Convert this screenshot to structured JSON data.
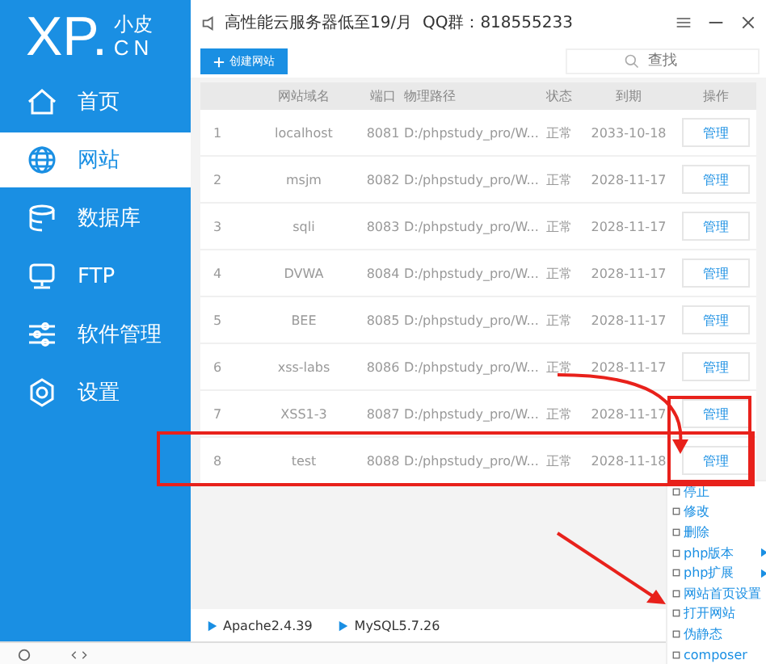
{
  "logo": {
    "main": "XP.",
    "top": "小皮",
    "bottom": "CN"
  },
  "sidebar": {
    "items": [
      {
        "label": "首页",
        "selected": false
      },
      {
        "label": "网站",
        "selected": true
      },
      {
        "label": "数据库",
        "selected": false
      },
      {
        "label": "FTP",
        "selected": false
      },
      {
        "label": "软件管理",
        "selected": false
      },
      {
        "label": "设置",
        "selected": false
      }
    ]
  },
  "title_bar": {
    "title": "高性能云服务器低至19/月  QQ群：818555233"
  },
  "toolbar": {
    "create_button": "创建网站",
    "search": {
      "placeholder": "查找"
    }
  },
  "table": {
    "columns": [
      "",
      "网站域名",
      "端口",
      "物理路径",
      "状态",
      "到期",
      "操作"
    ],
    "rows": [
      {
        "index": "1",
        "domain": "localhost",
        "port": "8081",
        "path": "D:/phpstudy_pro/W...",
        "status": "正常",
        "expires": "2033-10-18",
        "action": "管理"
      },
      {
        "index": "2",
        "domain": "msjm",
        "port": "8082",
        "path": "D:/phpstudy_pro/W...",
        "status": "正常",
        "expires": "2028-11-17",
        "action": "管理"
      },
      {
        "index": "3",
        "domain": "sqli",
        "port": "8083",
        "path": "D:/phpstudy_pro/W...",
        "status": "正常",
        "expires": "2028-11-17",
        "action": "管理"
      },
      {
        "index": "4",
        "domain": "DVWA",
        "port": "8084",
        "path": "D:/phpstudy_pro/W...",
        "status": "正常",
        "expires": "2028-11-17",
        "action": "管理"
      },
      {
        "index": "5",
        "domain": "BEE",
        "port": "8085",
        "path": "D:/phpstudy_pro/W...",
        "status": "正常",
        "expires": "2028-11-17",
        "action": "管理"
      },
      {
        "index": "6",
        "domain": "xss-labs",
        "port": "8086",
        "path": "D:/phpstudy_pro/W...",
        "status": "正常",
        "expires": "2028-11-17",
        "action": "管理"
      },
      {
        "index": "7",
        "domain": "XSS1-3",
        "port": "8087",
        "path": "D:/phpstudy_pro/W...",
        "status": "正常",
        "expires": "2028-11-17",
        "action": "管理"
      },
      {
        "index": "8",
        "domain": "test",
        "port": "8088",
        "path": "D:/phpstudy_pro/W...",
        "status": "正常",
        "expires": "2028-11-18",
        "action": "管理"
      }
    ]
  },
  "status_bar": [
    "Apache2.4.39",
    "MySQL5.7.26"
  ],
  "context_menu": {
    "items": [
      {
        "label": "停止",
        "submenu": false
      },
      {
        "label": "修改",
        "submenu": false
      },
      {
        "label": "删除",
        "submenu": false
      },
      {
        "label": "php版本",
        "submenu": true
      },
      {
        "label": "php扩展",
        "submenu": true
      },
      {
        "label": "网站首页设置",
        "submenu": false
      },
      {
        "label": "打开网站",
        "submenu": false
      },
      {
        "label": "伪静态",
        "submenu": false
      },
      {
        "label": "composer",
        "submenu": false
      }
    ]
  }
}
